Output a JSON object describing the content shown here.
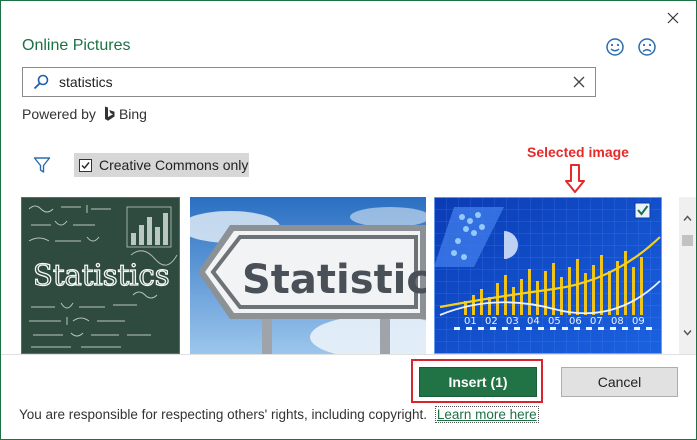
{
  "dialog": {
    "title": "Online Pictures",
    "close_icon": "close-icon",
    "feedback_icons": [
      "smile-icon",
      "frown-icon"
    ]
  },
  "search": {
    "value": "statistics",
    "icon": "search-icon",
    "clear_icon": "clear-icon"
  },
  "powered": {
    "prefix": "Powered by",
    "brand": "Bing"
  },
  "filter": {
    "icon": "filter-icon",
    "cc_label": "Creative Commons only",
    "cc_checked": true
  },
  "annotation": {
    "label": "Selected image"
  },
  "gallery": {
    "thumbs": [
      {
        "id": "chalkboard",
        "selected": false
      },
      {
        "id": "road-sign",
        "selected": false,
        "sign_text": "Statistics"
      },
      {
        "id": "blue-chart",
        "selected": true,
        "ticks": [
          "01",
          "02",
          "03",
          "04",
          "05",
          "06",
          "07",
          "08",
          "09"
        ]
      }
    ]
  },
  "actions": {
    "insert_label": "Insert (1)",
    "cancel_label": "Cancel"
  },
  "footer": {
    "text": "You are responsible for respecting others' rights, including copyright.",
    "link": "Learn more here"
  },
  "colors": {
    "accent": "#1e7145",
    "insert_bg": "#217346",
    "annotation": "#e32b2b"
  }
}
